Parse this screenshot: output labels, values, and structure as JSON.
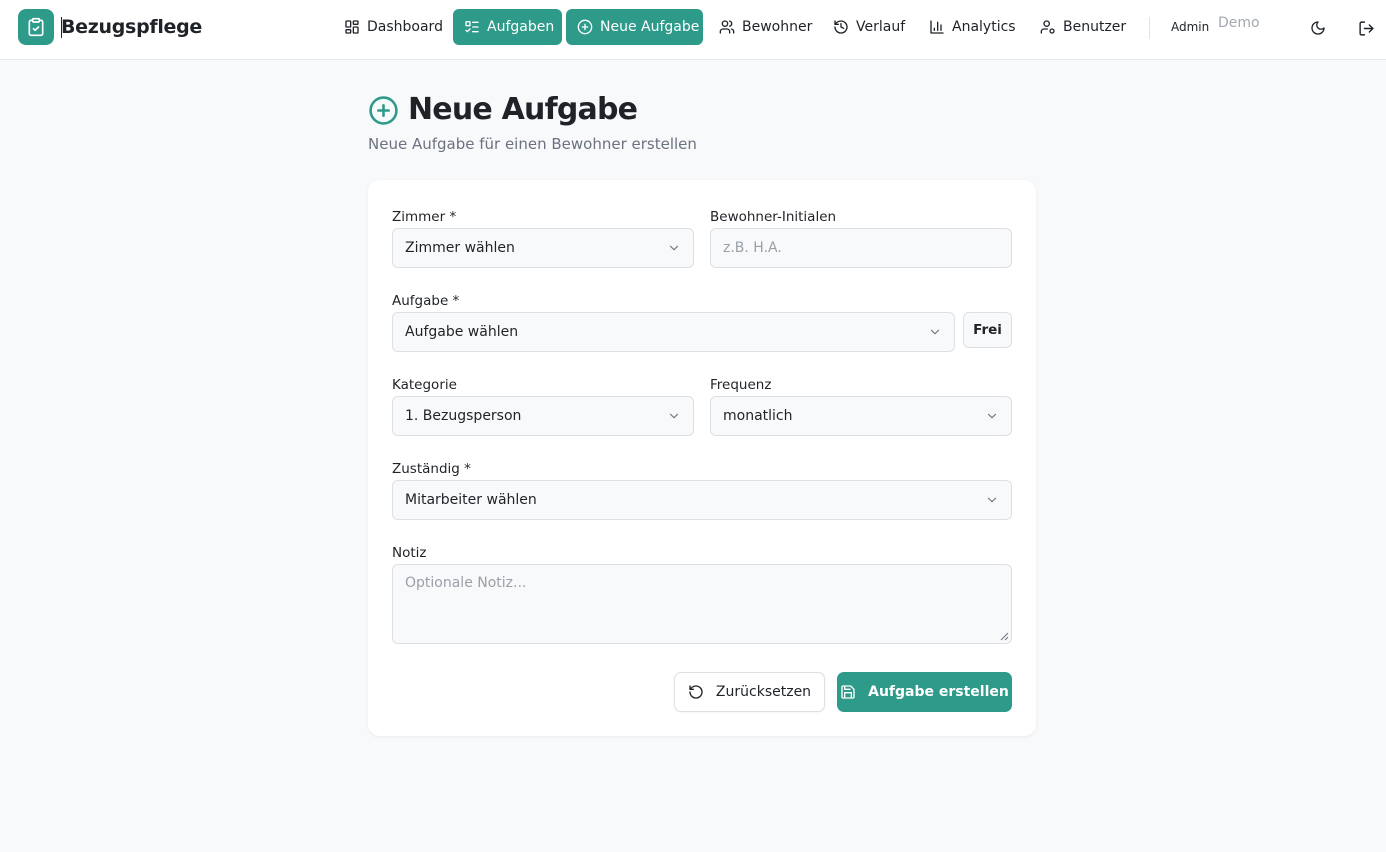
{
  "app": {
    "title": "Bezugspflege",
    "logo_icon": "clipboard-check-icon",
    "accent_color": "#2e9a8a"
  },
  "nav": {
    "items": [
      {
        "label": "Dashboard",
        "icon": "dashboard-icon",
        "state": "default"
      },
      {
        "label": "Aufgaben",
        "icon": "task-list-icon",
        "state": "active"
      },
      {
        "label": "Neue Aufgabe",
        "icon": "plus-circle-icon",
        "state": "primary"
      },
      {
        "label": "Bewohner",
        "icon": "users-icon",
        "state": "default"
      },
      {
        "label": "Verlauf",
        "icon": "history-icon",
        "state": "default"
      },
      {
        "label": "Analytics",
        "icon": "bar-chart-icon",
        "state": "default"
      },
      {
        "label": "Benutzer",
        "icon": "user-settings-icon",
        "state": "default"
      }
    ],
    "user_role": "Admin",
    "user_name": "Demo",
    "theme_toggle_icon": "moon-icon",
    "logout_icon": "logout-icon"
  },
  "page": {
    "icon": "plus-circle-icon",
    "title": "Neue Aufgabe",
    "subtitle": "Neue Aufgabe für einen Bewohner erstellen"
  },
  "form": {
    "zimmer": {
      "label": "Zimmer *",
      "value": "Zimmer wählen"
    },
    "initialen": {
      "label": "Bewohner-Initialen",
      "placeholder": "z.B. H.A.",
      "value": ""
    },
    "aufgabe": {
      "label": "Aufgabe *",
      "value": "Aufgabe wählen",
      "frei_label": "Frei"
    },
    "kategorie": {
      "label": "Kategorie",
      "value": "1. Bezugsperson"
    },
    "frequenz": {
      "label": "Frequenz",
      "value": "monatlich"
    },
    "zustaendig": {
      "label": "Zuständig *",
      "value": "Mitarbeiter wählen"
    },
    "notiz": {
      "label": "Notiz",
      "placeholder": "Optionale Notiz..."
    },
    "reset_label": "Zurücksetzen",
    "submit_label": "Aufgabe erstellen"
  }
}
